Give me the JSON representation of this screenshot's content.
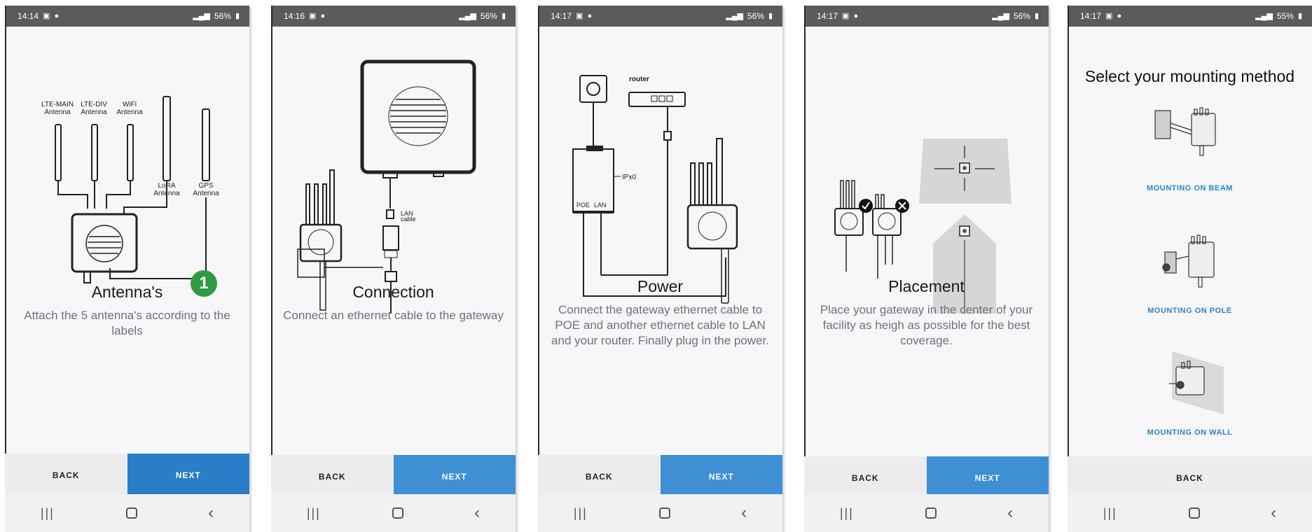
{
  "screens": [
    {
      "time": "14:14",
      "battery": "56%",
      "title": "Antenna's",
      "step_number": "1",
      "description": "Attach the 5 antenna's according to the labels",
      "labels": {
        "lte_main": "LTE-MAIN",
        "lte_div": "LTE-DIV",
        "wifi": "WiFi",
        "antenna": "Antenna",
        "lora": "LoRA",
        "gps": "GPS"
      },
      "back": "BACK",
      "next": "NEXT"
    },
    {
      "time": "14:16",
      "battery": "56%",
      "title": "Connection",
      "description": "Connect an ethernet cable to the gateway",
      "labels": {
        "lan": "LAN",
        "cable": "cable"
      },
      "back": "BACK",
      "next": "NEXT"
    },
    {
      "time": "14:17",
      "battery": "56%",
      "title": "Power",
      "description": "Connect the gateway ethernet cable to POE and another ethernet cable to LAN and your router. Finally plug in the power.",
      "labels": {
        "router": "router",
        "ipx0": "IPx0",
        "poe": "POE",
        "lan": "LAN"
      },
      "back": "BACK",
      "next": "NEXT"
    },
    {
      "time": "14:17",
      "battery": "56%",
      "title": "Placement",
      "description": "Place your gateway in the center of your facility as heigh as possible for the best coverage.",
      "back": "BACK",
      "next": "NEXT"
    },
    {
      "time": "14:17",
      "battery": "55%",
      "title": "Select your mounting method",
      "options": [
        "MOUNTING ON BEAM",
        "MOUNTING ON POLE",
        "MOUNTING ON WALL"
      ],
      "back": "BACK"
    }
  ],
  "colors": {
    "accent": "#3f8fd5",
    "badge": "#2e9b42",
    "link": "#2d86c7"
  }
}
